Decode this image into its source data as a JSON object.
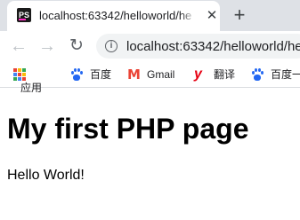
{
  "tab": {
    "favicon_text": "PS",
    "title": "localhost:63342/helloworld/he",
    "close_glyph": "✕",
    "new_tab_glyph": "+"
  },
  "toolbar": {
    "back_glyph": "←",
    "forward_glyph": "→",
    "reload_glyph": "↻",
    "info_glyph": "i",
    "url": "localhost:63342/helloworld/he"
  },
  "bookmarks": [
    {
      "label": "应用",
      "icon": "apps-grid-icon"
    },
    {
      "label": "百度",
      "icon": "baidu-paw-icon"
    },
    {
      "label": "Gmail",
      "icon": "gmail-icon"
    },
    {
      "label": "翻译",
      "icon": "youdao-icon"
    },
    {
      "label": "百度一",
      "icon": "baidu-paw-icon"
    }
  ],
  "icons": {
    "gmail_glyph": "M",
    "youdao_glyph": "y"
  },
  "page": {
    "heading": "My first PHP page",
    "text": "Hello World!"
  },
  "colors": {
    "tabstrip_bg": "#dee1e6",
    "omnibox_bg": "#f1f3f4",
    "baidu_blue": "#2468f2",
    "gmail_red": "#ea4335",
    "youdao_red": "#e60012",
    "phpstorm_pink": "#ff2ac3"
  }
}
